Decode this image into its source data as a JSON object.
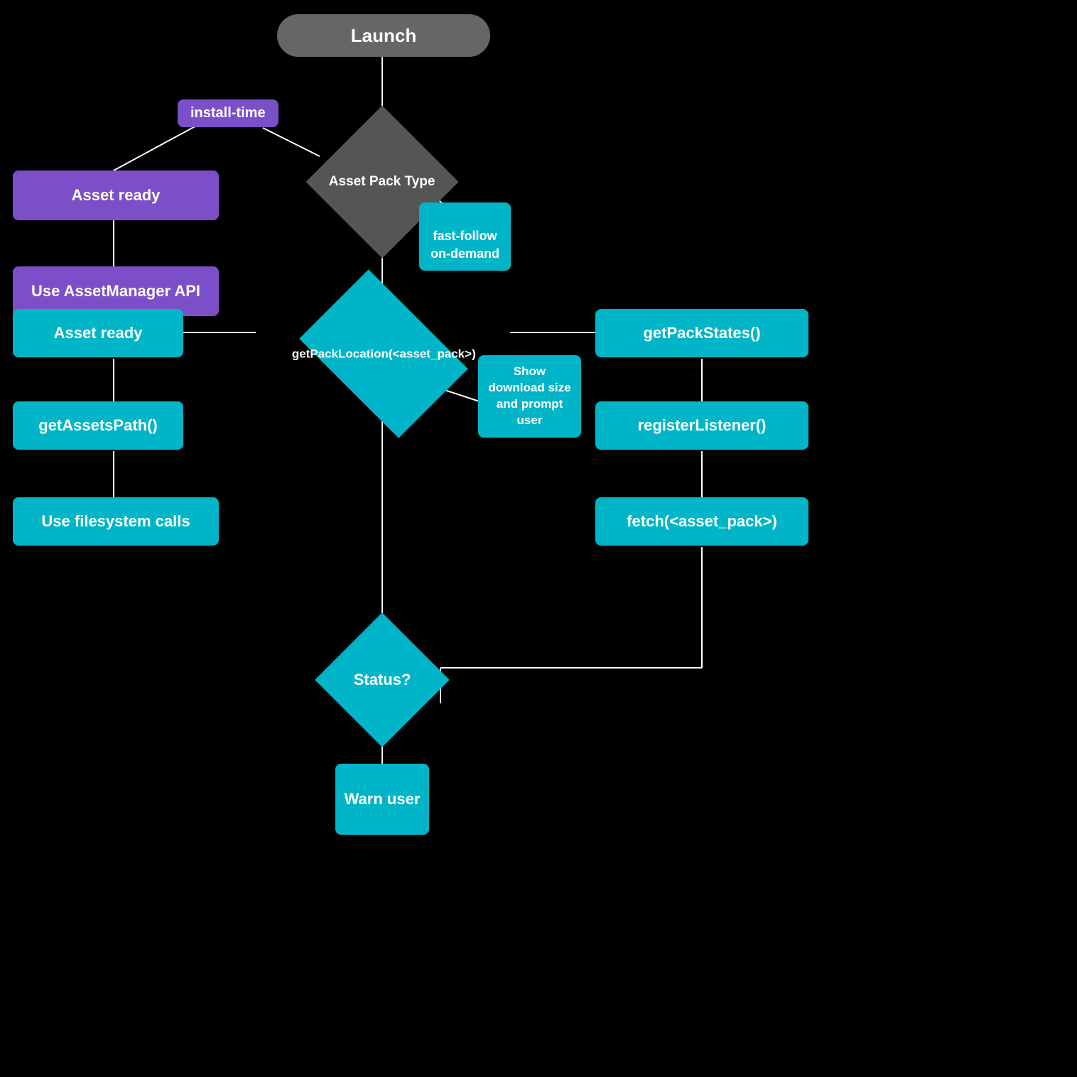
{
  "nodes": {
    "launch": {
      "label": "Launch"
    },
    "assetPackType": {
      "label": "Asset Pack Type"
    },
    "installTime": {
      "label": "install-time"
    },
    "fastFollow": {
      "label": "fast-follow\non-demand"
    },
    "assetReady1": {
      "label": "Asset ready"
    },
    "useAssetManagerAPI": {
      "label": "Use AssetManager API"
    },
    "getPackLocation": {
      "label": "getPackLocation(<asset_pack>)"
    },
    "assetReady2": {
      "label": "Asset ready"
    },
    "getAssetsPath": {
      "label": "getAssetsPath()"
    },
    "useFilesystemCalls": {
      "label": "Use filesystem calls"
    },
    "showDownload": {
      "label": "Show download size and prompt user"
    },
    "getPackStates": {
      "label": "getPackStates()"
    },
    "registerListener": {
      "label": "registerListener()"
    },
    "fetchAssetPack": {
      "label": "fetch(<asset_pack>)"
    },
    "status": {
      "label": "Status?"
    },
    "warnUser": {
      "label": "Warn user"
    }
  },
  "colors": {
    "bg": "#000000",
    "launch": "#666666",
    "diamond_dark": "#555555",
    "diamond_teal": "#00b5c8",
    "purple": "#7b4fc8",
    "teal": "#00b5c8",
    "label_teal": "#00b5c8",
    "white": "#ffffff"
  }
}
